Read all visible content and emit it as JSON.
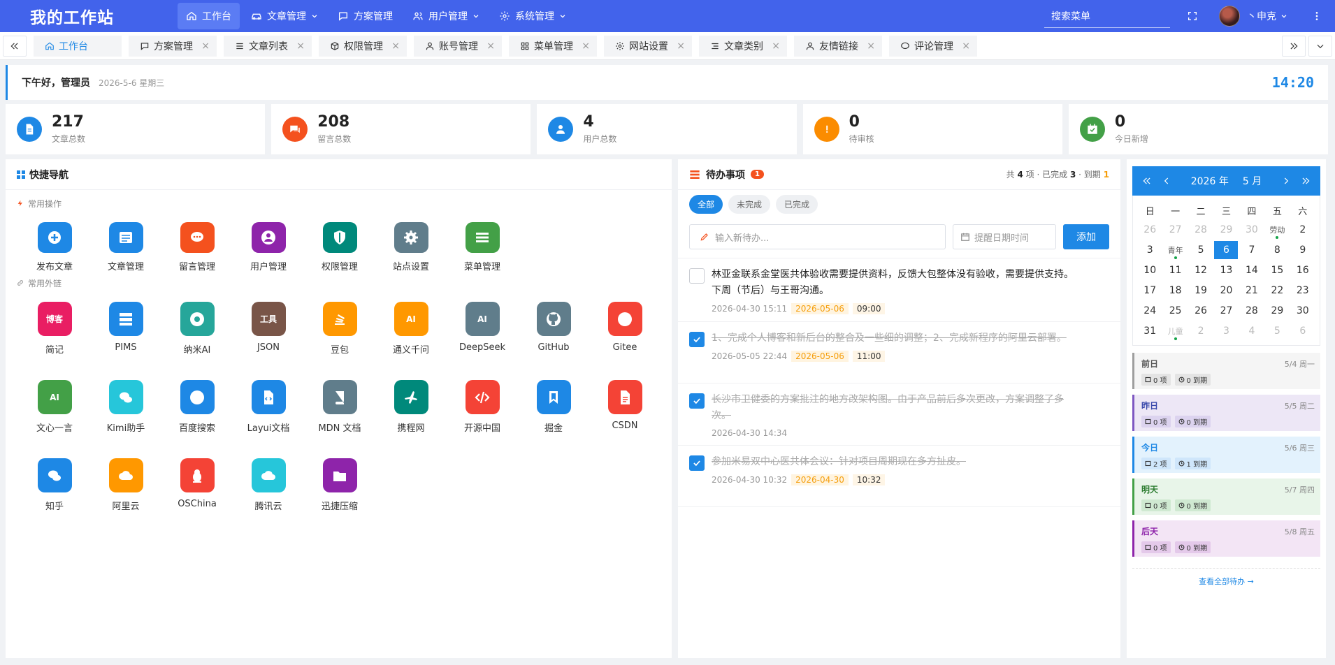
{
  "header": {
    "brand": "我的工作站",
    "nav": [
      {
        "label": "工作台",
        "icon": "home-icon",
        "active": true,
        "dropdown": false
      },
      {
        "label": "文章管理",
        "icon": "car-icon",
        "active": false,
        "dropdown": true
      },
      {
        "label": "方案管理",
        "icon": "chat-icon",
        "active": false,
        "dropdown": false
      },
      {
        "label": "用户管理",
        "icon": "users-icon",
        "active": false,
        "dropdown": true
      },
      {
        "label": "系统管理",
        "icon": "gear-icon",
        "active": false,
        "dropdown": true
      }
    ],
    "search_placeholder": "搜索菜单",
    "username": "丶申克"
  },
  "tabs": [
    {
      "label": "工作台",
      "icon": "home-icon",
      "active": true,
      "closable": false
    },
    {
      "label": "方案管理",
      "icon": "chat-icon",
      "active": false,
      "closable": true
    },
    {
      "label": "文章列表",
      "icon": "list-icon",
      "active": false,
      "closable": true
    },
    {
      "label": "权限管理",
      "icon": "cube-icon",
      "active": false,
      "closable": true
    },
    {
      "label": "账号管理",
      "icon": "user-icon",
      "active": false,
      "closable": true
    },
    {
      "label": "菜单管理",
      "icon": "menu-grid-icon",
      "active": false,
      "closable": true
    },
    {
      "label": "网站设置",
      "icon": "gear-icon",
      "active": false,
      "closable": true
    },
    {
      "label": "文章类别",
      "icon": "category-icon",
      "active": false,
      "closable": true
    },
    {
      "label": "友情链接",
      "icon": "people-icon",
      "active": false,
      "closable": true
    },
    {
      "label": "评论管理",
      "icon": "comment-icon",
      "active": false,
      "closable": true
    }
  ],
  "greeting": {
    "text": "下午好，管理员",
    "date": "2026-5-6 星期三",
    "clock": "14:20"
  },
  "stats": [
    {
      "value": "217",
      "label": "文章总数",
      "color": "#1e88e5",
      "icon": "document-icon"
    },
    {
      "value": "208",
      "label": "留言总数",
      "color": "#f4511e",
      "icon": "chat-icon"
    },
    {
      "value": "4",
      "label": "用户总数",
      "color": "#1e88e5",
      "icon": "user-icon"
    },
    {
      "value": "0",
      "label": "待审核",
      "color": "#fb8c00",
      "icon": "alert-icon"
    },
    {
      "value": "0",
      "label": "今日新增",
      "color": "#43a047",
      "icon": "calendar-check-icon"
    }
  ],
  "quick": {
    "title": "快捷导航",
    "ops_title": "常用操作",
    "links_title": "常用外链",
    "ops": [
      {
        "label": "发布文章",
        "color": "#1e88e5",
        "icon": "plus-circle-icon"
      },
      {
        "label": "文章管理",
        "color": "#1e88e5",
        "icon": "article-icon"
      },
      {
        "label": "留言管理",
        "color": "#f4511e",
        "icon": "message-icon"
      },
      {
        "label": "用户管理",
        "color": "#8e24aa",
        "icon": "user-circle-icon"
      },
      {
        "label": "权限管理",
        "color": "#00897b",
        "icon": "shield-icon"
      },
      {
        "label": "站点设置",
        "color": "#607d8b",
        "icon": "gear-icon"
      },
      {
        "label": "菜单管理",
        "color": "#43a047",
        "icon": "list-icon"
      }
    ],
    "links": [
      {
        "label": "简记",
        "color": "#e91e63",
        "text": "博客",
        "icon": "blog-icon"
      },
      {
        "label": "PIMS",
        "color": "#1e88e5",
        "text": "",
        "icon": "server-icon"
      },
      {
        "label": "纳米AI",
        "color": "#26a69a",
        "text": "",
        "icon": "chrome-icon"
      },
      {
        "label": "JSON",
        "color": "#795548",
        "text": "工具",
        "icon": "tool-icon"
      },
      {
        "label": "豆包",
        "color": "#ff9800",
        "text": "",
        "icon": "stack-icon"
      },
      {
        "label": "通义千问",
        "color": "#ff9800",
        "text": "AI",
        "icon": "ai-icon"
      },
      {
        "label": "DeepSeek",
        "color": "#607d8b",
        "text": "AI",
        "icon": "ai-icon"
      },
      {
        "label": "GitHub",
        "color": "#607d8b",
        "text": "",
        "icon": "github-icon"
      },
      {
        "label": "Gitee",
        "color": "#f44336",
        "text": "",
        "icon": "globe-icon"
      },
      {
        "label": "文心一言",
        "color": "#43a047",
        "text": "AI",
        "icon": "ai-icon"
      },
      {
        "label": "Kimi助手",
        "color": "#26c6da",
        "text": "",
        "icon": "chat-bubbles-icon"
      },
      {
        "label": "百度搜索",
        "color": "#1e88e5",
        "text": "",
        "icon": "globe-icon"
      },
      {
        "label": "Layui文档",
        "color": "#1e88e5",
        "text": "",
        "icon": "code-file-icon"
      },
      {
        "label": "MDN 文档",
        "color": "#607d8b",
        "text": "",
        "icon": "book-icon"
      },
      {
        "label": "携程网",
        "color": "#00897b",
        "text": "",
        "icon": "plane-icon"
      },
      {
        "label": "开源中国",
        "color": "#f44336",
        "text": "",
        "icon": "code-icon"
      },
      {
        "label": "掘金",
        "color": "#1e88e5",
        "text": "",
        "icon": "bookmark-icon"
      },
      {
        "label": "CSDN",
        "color": "#f44336",
        "text": "",
        "icon": "pdf-icon"
      },
      {
        "label": "知乎",
        "color": "#1e88e5",
        "text": "",
        "icon": "chat-bubbles-icon"
      },
      {
        "label": "阿里云",
        "color": "#ff9800",
        "text": "",
        "icon": "cloud-icon"
      },
      {
        "label": "OSChina",
        "color": "#f44336",
        "text": "",
        "icon": "linux-icon"
      },
      {
        "label": "腾讯云",
        "color": "#26c6da",
        "text": "",
        "icon": "cloud-icon"
      },
      {
        "label": "迅捷压缩",
        "color": "#8e24aa",
        "text": "",
        "icon": "folder-icon"
      }
    ]
  },
  "todo": {
    "title": "待办事项",
    "badge": "1",
    "summary": {
      "p1": "共",
      "total": "4",
      "p2": "项 · 已完成",
      "done": "3",
      "p3": "· 到期",
      "due": "1"
    },
    "filters": [
      {
        "label": "全部",
        "active": true
      },
      {
        "label": "未完成",
        "active": false
      },
      {
        "label": "已完成",
        "active": false
      }
    ],
    "input_placeholder": "输入新待办...",
    "date_placeholder": "提醒日期时间",
    "add_label": "添加",
    "items": [
      {
        "text": "林亚金联系金堂医共体验收需要提供资料，反馈大包整体没有验收，需要提供支持。下周（节后）与王哥沟通。",
        "done": false,
        "created": "2026-04-30 15:11",
        "remind_date": "2026-05-06",
        "remind_time": "09:00"
      },
      {
        "text": "1、完成个人博客和新后台的整合及一些细的调整；2、完成新程序的阿里云部署。",
        "done": true,
        "created": "2026-05-05 22:44",
        "remind_date": "2026-05-06",
        "remind_time": "11:00"
      },
      {
        "text": "长沙市卫健委的方案批注的地方改架构图。由于产品前后多次更改，方案调整了多次。",
        "done": true,
        "created": "2026-04-30 14:34",
        "remind_date": "",
        "remind_time": ""
      },
      {
        "text": "参加米易双中心医共体会议：针对项目周期现在多方扯皮。",
        "done": true,
        "created": "2026-04-30 10:32",
        "remind_date": "2026-04-30",
        "remind_time": "10:32"
      }
    ]
  },
  "calendar": {
    "year": "2026 年",
    "month": "5 月",
    "weekdays": [
      "日",
      "一",
      "二",
      "三",
      "四",
      "五",
      "六"
    ],
    "cells": [
      {
        "t": "26",
        "dim": true
      },
      {
        "t": "27",
        "dim": true
      },
      {
        "t": "28",
        "dim": true
      },
      {
        "t": "29",
        "dim": true
      },
      {
        "t": "30",
        "dim": true
      },
      {
        "t": "劳动",
        "fest": true,
        "dot": true
      },
      {
        "t": "2"
      },
      {
        "t": "3"
      },
      {
        "t": "青年",
        "fest": true,
        "dot": true
      },
      {
        "t": "5"
      },
      {
        "t": "6",
        "today": true
      },
      {
        "t": "7"
      },
      {
        "t": "8"
      },
      {
        "t": "9"
      },
      {
        "t": "10"
      },
      {
        "t": "11"
      },
      {
        "t": "12"
      },
      {
        "t": "13"
      },
      {
        "t": "14"
      },
      {
        "t": "15"
      },
      {
        "t": "16"
      },
      {
        "t": "17"
      },
      {
        "t": "18"
      },
      {
        "t": "19"
      },
      {
        "t": "20"
      },
      {
        "t": "21"
      },
      {
        "t": "22"
      },
      {
        "t": "23"
      },
      {
        "t": "24"
      },
      {
        "t": "25"
      },
      {
        "t": "26"
      },
      {
        "t": "27"
      },
      {
        "t": "28"
      },
      {
        "t": "29"
      },
      {
        "t": "30"
      },
      {
        "t": "31"
      },
      {
        "t": "儿童",
        "fest": true,
        "dim": true,
        "dot": true
      },
      {
        "t": "2",
        "dim": true
      },
      {
        "t": "3",
        "dim": true
      },
      {
        "t": "4",
        "dim": true
      },
      {
        "t": "5",
        "dim": true
      },
      {
        "t": "6",
        "dim": true
      }
    ],
    "days": [
      {
        "name": "前日",
        "date": "5/4 周一",
        "items": "0 项",
        "due": "0 到期",
        "border": "#9e9e9e",
        "bg": "#f5f5f5",
        "color": "#555",
        "tag_bg": "#e4e4e4"
      },
      {
        "name": "昨日",
        "date": "5/5 周二",
        "items": "0 项",
        "due": "0 到期",
        "border": "#7e57c2",
        "bg": "#ede7f6",
        "color": "#3949ab",
        "tag_bg": "#dcd3ef"
      },
      {
        "name": "今日",
        "date": "5/6 周三",
        "items": "2 项",
        "due": "1 到期",
        "border": "#1e88e5",
        "bg": "#e3f2fd",
        "color": "#1e88e5",
        "tag_bg": "#cfe6fb"
      },
      {
        "name": "明天",
        "date": "5/7 周四",
        "items": "0 项",
        "due": "0 到期",
        "border": "#43a047",
        "bg": "#e8f5e9",
        "color": "#2e7d32",
        "tag_bg": "#cfe9d1"
      },
      {
        "name": "后天",
        "date": "5/8 周五",
        "items": "0 项",
        "due": "0 到期",
        "border": "#8e24aa",
        "bg": "#f3e5f5",
        "color": "#8e24aa",
        "tag_bg": "#e4c9ea"
      }
    ],
    "view_all": "查看全部待办 →"
  }
}
